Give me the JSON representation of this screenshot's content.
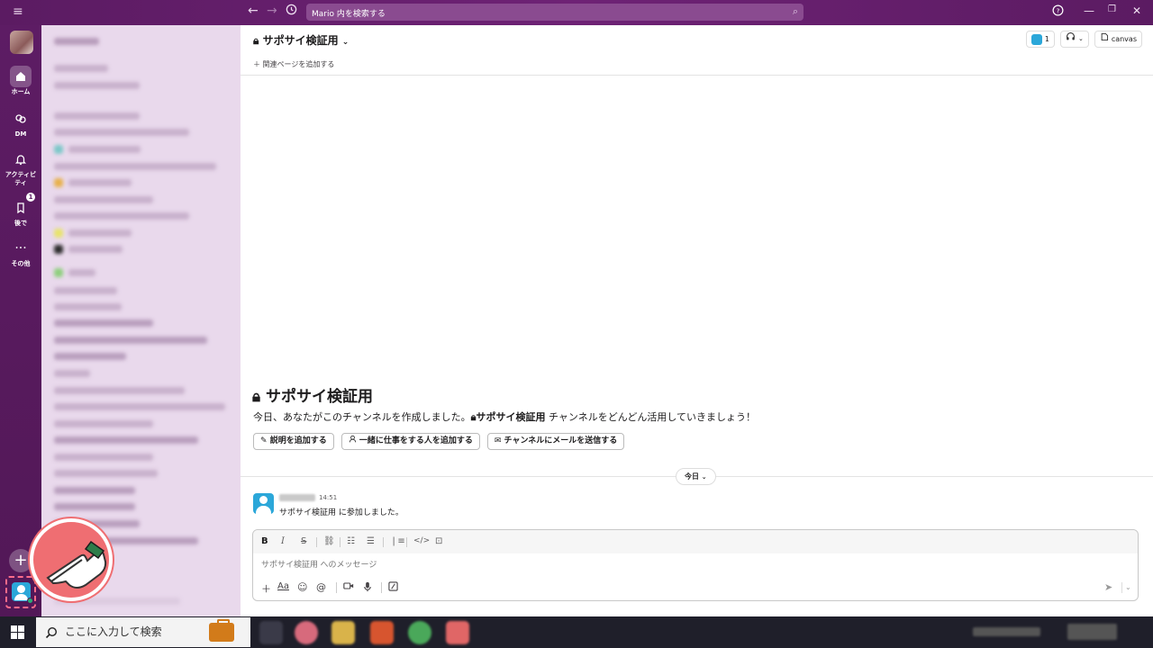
{
  "topbar": {
    "search_placeholder": "Mario 内を検索する",
    "help": "?",
    "minimize": "—",
    "restore": "❐",
    "close": "✕"
  },
  "rail": {
    "home": "ホーム",
    "dm": "DM",
    "activity": "アクティビティ",
    "later": "後で",
    "later_badge": "1",
    "more": "その他"
  },
  "channel": {
    "title": "サポサイ検証用",
    "member_count": "1",
    "canvas_label": "canvas",
    "add_bookmark": "関連ページを追加する"
  },
  "intro": {
    "title": "サポサイ検証用",
    "text_before": "今日、あなたがこのチャンネルを作成しました。",
    "channel_name": "サポサイ検証用",
    "text_after": " チャンネルをどんどん活用していきましょう！",
    "buttons": [
      "説明を追加する",
      "一緒に仕事をする人を追加する",
      "チャンネルにメールを送信する"
    ]
  },
  "date_divider": "今日",
  "message": {
    "time": "14:51",
    "text": "サポサイ検証用 に参加しました。"
  },
  "composer": {
    "placeholder": "サポサイ検証用 へのメッセージ",
    "aa": "Aa"
  },
  "taskbar": {
    "search_placeholder": "ここに入力して検索"
  },
  "colors": {
    "aubergine": "#5b1b62",
    "accent_blue": "#2ba7d9",
    "hand_red": "#ef6e72",
    "highlight_dash": "#ff6b8a"
  }
}
